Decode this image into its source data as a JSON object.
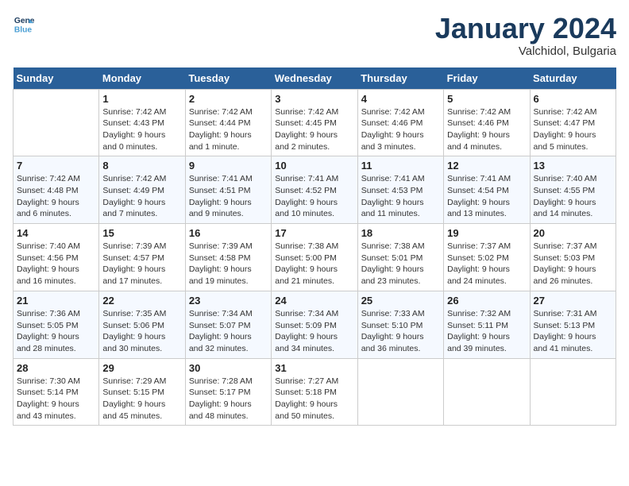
{
  "header": {
    "logo_line1": "General",
    "logo_line2": "Blue",
    "month_title": "January 2024",
    "subtitle": "Valchidol, Bulgaria"
  },
  "weekdays": [
    "Sunday",
    "Monday",
    "Tuesday",
    "Wednesday",
    "Thursday",
    "Friday",
    "Saturday"
  ],
  "weeks": [
    [
      {
        "day": "",
        "info": ""
      },
      {
        "day": "1",
        "info": "Sunrise: 7:42 AM\nSunset: 4:43 PM\nDaylight: 9 hours\nand 0 minutes."
      },
      {
        "day": "2",
        "info": "Sunrise: 7:42 AM\nSunset: 4:44 PM\nDaylight: 9 hours\nand 1 minute."
      },
      {
        "day": "3",
        "info": "Sunrise: 7:42 AM\nSunset: 4:45 PM\nDaylight: 9 hours\nand 2 minutes."
      },
      {
        "day": "4",
        "info": "Sunrise: 7:42 AM\nSunset: 4:46 PM\nDaylight: 9 hours\nand 3 minutes."
      },
      {
        "day": "5",
        "info": "Sunrise: 7:42 AM\nSunset: 4:46 PM\nDaylight: 9 hours\nand 4 minutes."
      },
      {
        "day": "6",
        "info": "Sunrise: 7:42 AM\nSunset: 4:47 PM\nDaylight: 9 hours\nand 5 minutes."
      }
    ],
    [
      {
        "day": "7",
        "info": "Sunrise: 7:42 AM\nSunset: 4:48 PM\nDaylight: 9 hours\nand 6 minutes."
      },
      {
        "day": "8",
        "info": "Sunrise: 7:42 AM\nSunset: 4:49 PM\nDaylight: 9 hours\nand 7 minutes."
      },
      {
        "day": "9",
        "info": "Sunrise: 7:41 AM\nSunset: 4:51 PM\nDaylight: 9 hours\nand 9 minutes."
      },
      {
        "day": "10",
        "info": "Sunrise: 7:41 AM\nSunset: 4:52 PM\nDaylight: 9 hours\nand 10 minutes."
      },
      {
        "day": "11",
        "info": "Sunrise: 7:41 AM\nSunset: 4:53 PM\nDaylight: 9 hours\nand 11 minutes."
      },
      {
        "day": "12",
        "info": "Sunrise: 7:41 AM\nSunset: 4:54 PM\nDaylight: 9 hours\nand 13 minutes."
      },
      {
        "day": "13",
        "info": "Sunrise: 7:40 AM\nSunset: 4:55 PM\nDaylight: 9 hours\nand 14 minutes."
      }
    ],
    [
      {
        "day": "14",
        "info": "Sunrise: 7:40 AM\nSunset: 4:56 PM\nDaylight: 9 hours\nand 16 minutes."
      },
      {
        "day": "15",
        "info": "Sunrise: 7:39 AM\nSunset: 4:57 PM\nDaylight: 9 hours\nand 17 minutes."
      },
      {
        "day": "16",
        "info": "Sunrise: 7:39 AM\nSunset: 4:58 PM\nDaylight: 9 hours\nand 19 minutes."
      },
      {
        "day": "17",
        "info": "Sunrise: 7:38 AM\nSunset: 5:00 PM\nDaylight: 9 hours\nand 21 minutes."
      },
      {
        "day": "18",
        "info": "Sunrise: 7:38 AM\nSunset: 5:01 PM\nDaylight: 9 hours\nand 23 minutes."
      },
      {
        "day": "19",
        "info": "Sunrise: 7:37 AM\nSunset: 5:02 PM\nDaylight: 9 hours\nand 24 minutes."
      },
      {
        "day": "20",
        "info": "Sunrise: 7:37 AM\nSunset: 5:03 PM\nDaylight: 9 hours\nand 26 minutes."
      }
    ],
    [
      {
        "day": "21",
        "info": "Sunrise: 7:36 AM\nSunset: 5:05 PM\nDaylight: 9 hours\nand 28 minutes."
      },
      {
        "day": "22",
        "info": "Sunrise: 7:35 AM\nSunset: 5:06 PM\nDaylight: 9 hours\nand 30 minutes."
      },
      {
        "day": "23",
        "info": "Sunrise: 7:34 AM\nSunset: 5:07 PM\nDaylight: 9 hours\nand 32 minutes."
      },
      {
        "day": "24",
        "info": "Sunrise: 7:34 AM\nSunset: 5:09 PM\nDaylight: 9 hours\nand 34 minutes."
      },
      {
        "day": "25",
        "info": "Sunrise: 7:33 AM\nSunset: 5:10 PM\nDaylight: 9 hours\nand 36 minutes."
      },
      {
        "day": "26",
        "info": "Sunrise: 7:32 AM\nSunset: 5:11 PM\nDaylight: 9 hours\nand 39 minutes."
      },
      {
        "day": "27",
        "info": "Sunrise: 7:31 AM\nSunset: 5:13 PM\nDaylight: 9 hours\nand 41 minutes."
      }
    ],
    [
      {
        "day": "28",
        "info": "Sunrise: 7:30 AM\nSunset: 5:14 PM\nDaylight: 9 hours\nand 43 minutes."
      },
      {
        "day": "29",
        "info": "Sunrise: 7:29 AM\nSunset: 5:15 PM\nDaylight: 9 hours\nand 45 minutes."
      },
      {
        "day": "30",
        "info": "Sunrise: 7:28 AM\nSunset: 5:17 PM\nDaylight: 9 hours\nand 48 minutes."
      },
      {
        "day": "31",
        "info": "Sunrise: 7:27 AM\nSunset: 5:18 PM\nDaylight: 9 hours\nand 50 minutes."
      },
      {
        "day": "",
        "info": ""
      },
      {
        "day": "",
        "info": ""
      },
      {
        "day": "",
        "info": ""
      }
    ]
  ]
}
